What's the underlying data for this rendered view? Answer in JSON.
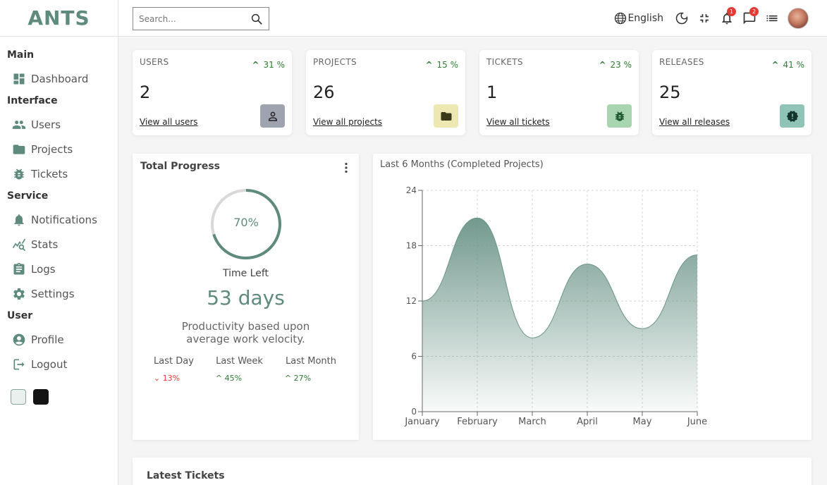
{
  "brand": {
    "logo": "ANTS"
  },
  "sidebar": {
    "sections": [
      {
        "title": "Main",
        "items": [
          {
            "label": "Dashboard",
            "icon": "dashboard-icon"
          }
        ]
      },
      {
        "title": "Interface",
        "items": [
          {
            "label": "Users",
            "icon": "users-icon"
          },
          {
            "label": "Projects",
            "icon": "folder-icon"
          },
          {
            "label": "Tickets",
            "icon": "bug-icon"
          }
        ]
      },
      {
        "title": "Service",
        "items": [
          {
            "label": "Notifications",
            "icon": "bell-icon"
          },
          {
            "label": "Stats",
            "icon": "stats-icon"
          },
          {
            "label": "Logs",
            "icon": "clipboard-icon"
          },
          {
            "label": "Settings",
            "icon": "gear-icon"
          }
        ]
      },
      {
        "title": "User",
        "items": [
          {
            "label": "Profile",
            "icon": "profile-icon"
          },
          {
            "label": "Logout",
            "icon": "logout-icon"
          }
        ]
      }
    ],
    "themes": [
      {
        "name": "light",
        "color": "#e9f0ee"
      },
      {
        "name": "dark",
        "color": "#141414"
      }
    ]
  },
  "topbar": {
    "search_placeholder": "Search...",
    "language": "English",
    "notifications_count": "1",
    "messages_count": "2"
  },
  "stats": [
    {
      "title": "USERS",
      "value": "2",
      "change": "31 %",
      "link": "View all users",
      "icon": "person-icon",
      "icon_bg": "#9ea3b0"
    },
    {
      "title": "PROJECTS",
      "value": "26",
      "change": "15 %",
      "link": "View all projects",
      "icon": "folder-icon",
      "icon_bg": "#ede7b1"
    },
    {
      "title": "TICKETS",
      "value": "1",
      "change": "23 %",
      "link": "View all tickets",
      "icon": "bug-icon",
      "icon_bg": "#a8d5b0"
    },
    {
      "title": "RELEASES",
      "value": "25",
      "change": "41 %",
      "link": "View all releases",
      "icon": "alert-badge-icon",
      "icon_bg": "#8fc4b6"
    }
  ],
  "progress": {
    "title": "Total Progress",
    "percent_label": "70%",
    "percent": 0.7,
    "time_left_label": "Time Left",
    "days": "53 days",
    "description": "Productivity based upon average work velocity.",
    "periods": [
      {
        "label": "Last Day",
        "value": "13%",
        "trend": "down"
      },
      {
        "label": "Last Week",
        "value": "45%",
        "trend": "up"
      },
      {
        "label": "Last Month",
        "value": "27%",
        "trend": "up"
      }
    ]
  },
  "chart_data": {
    "type": "area",
    "title": "Last 6 Months (Completed Projects)",
    "categories": [
      "January",
      "February",
      "March",
      "April",
      "May",
      "June"
    ],
    "series": [
      {
        "values": [
          12,
          21,
          8,
          16,
          9,
          17
        ]
      }
    ],
    "ylim": [
      0,
      24
    ],
    "yticks": [
      0,
      6,
      12,
      18,
      24
    ],
    "grid": true,
    "color": "#6b9488"
  },
  "tickets": {
    "title": "Latest Tickets"
  },
  "colors": {
    "accent": "#5f8a7e",
    "up": "#2e7d32",
    "down": "#e53935"
  }
}
